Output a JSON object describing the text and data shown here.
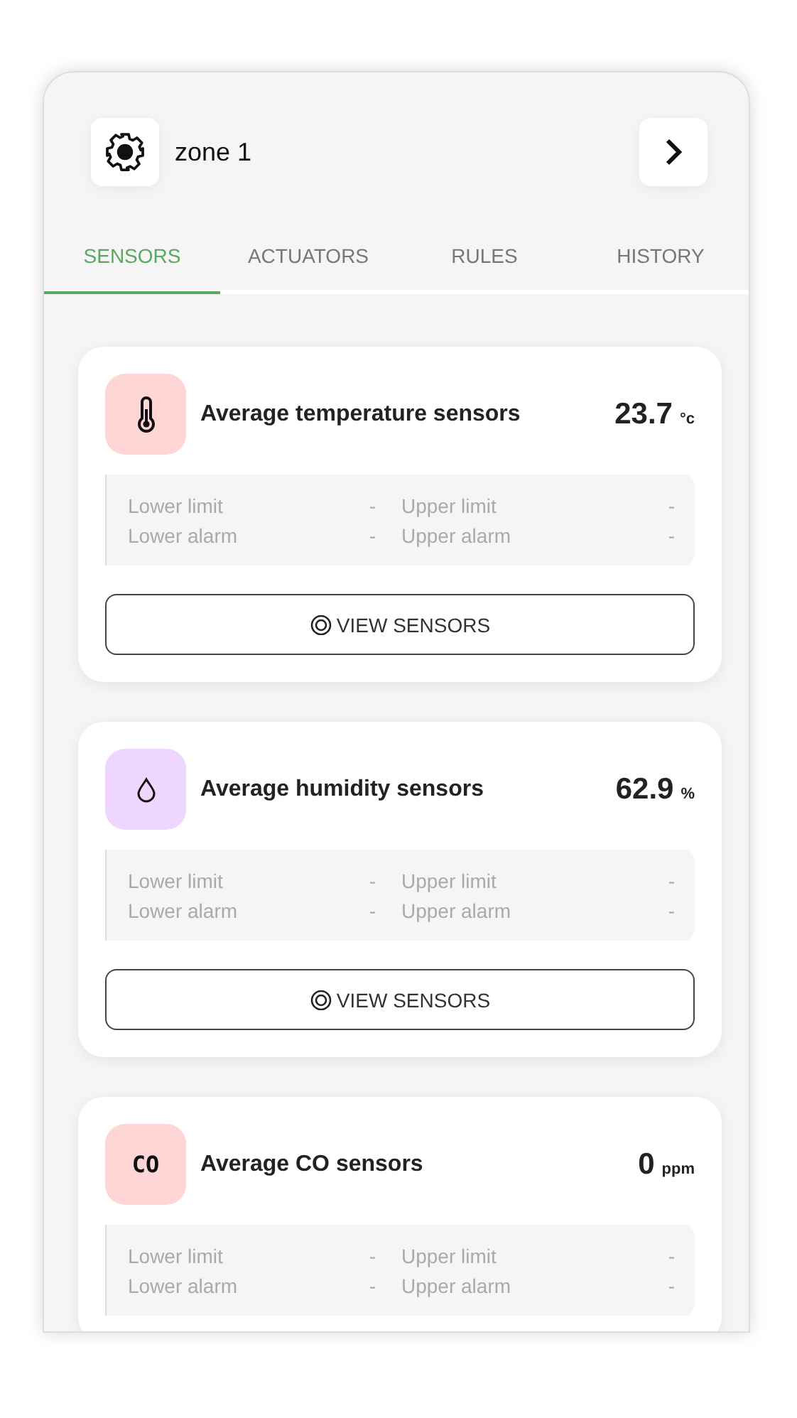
{
  "header": {
    "title": "zone 1"
  },
  "tabs": [
    {
      "label": "SENSORS",
      "selected": true
    },
    {
      "label": "ACTUATORS",
      "selected": false
    },
    {
      "label": "RULES",
      "selected": false
    },
    {
      "label": "HISTORY",
      "selected": false
    }
  ],
  "cards": [
    {
      "kind": "temperature",
      "color": "#ffd6d6",
      "title": "Average temperature sensors",
      "value": "23.7",
      "unit": "°c",
      "limits": [
        {
          "label": "Lower limit",
          "value": "-"
        },
        {
          "label": "Upper limit",
          "value": "-"
        },
        {
          "label": "Lower alarm",
          "value": "-"
        },
        {
          "label": "Upper alarm",
          "value": "-"
        }
      ],
      "button": "VIEW SENSORS"
    },
    {
      "kind": "humidity",
      "color": "#efd6ff",
      "title": "Average humidity sensors",
      "value": "62.9",
      "unit": "%",
      "limits": [
        {
          "label": "Lower limit",
          "value": "-"
        },
        {
          "label": "Upper limit",
          "value": "-"
        },
        {
          "label": "Lower alarm",
          "value": "-"
        },
        {
          "label": "Upper alarm",
          "value": "-"
        }
      ],
      "button": "VIEW SENSORS"
    },
    {
      "kind": "co",
      "color": "#ffd6d6",
      "icon_label": "CO",
      "title": "Average CO sensors",
      "value": "0",
      "unit": "ppm",
      "limits": [
        {
          "label": "Lower limit",
          "value": "-"
        },
        {
          "label": "Upper limit",
          "value": "-"
        },
        {
          "label": "Lower alarm",
          "value": "-"
        },
        {
          "label": "Upper alarm",
          "value": "-"
        }
      ]
    }
  ]
}
